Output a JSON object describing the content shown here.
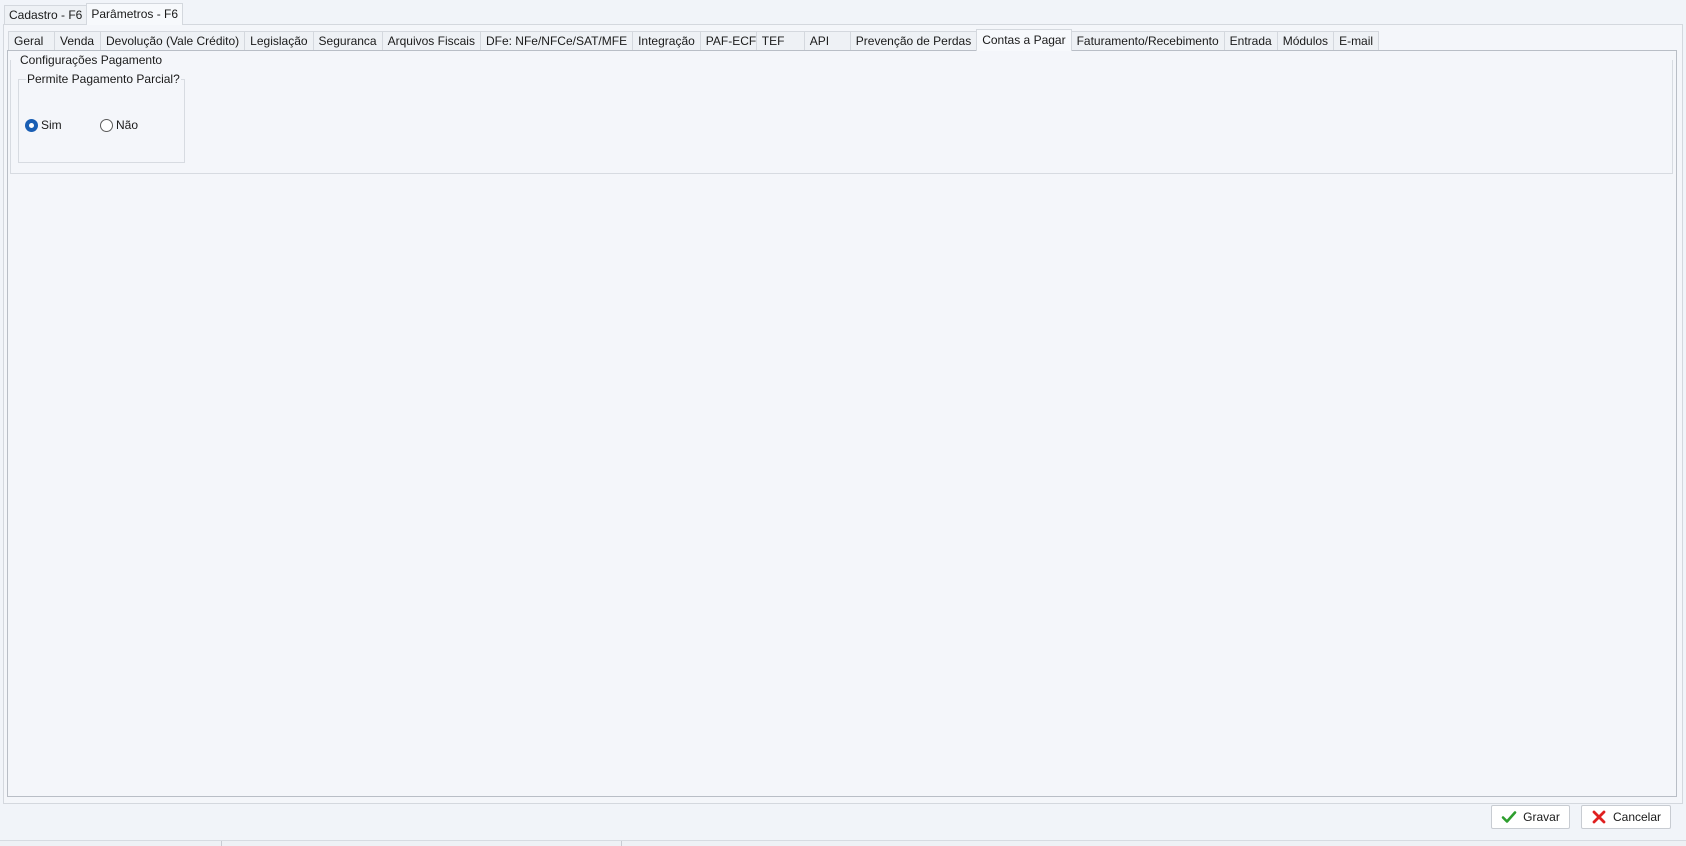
{
  "top_tabs": [
    {
      "label": "Cadastro - F6",
      "active": false
    },
    {
      "label": "Parâmetros - F6",
      "active": true
    }
  ],
  "inner_tabs": [
    {
      "label": "Geral"
    },
    {
      "label": "Venda"
    },
    {
      "label": "Devolução (Vale Crédito)"
    },
    {
      "label": "Legislação"
    },
    {
      "label": "Seguranca"
    },
    {
      "label": "Arquivos Fiscais"
    },
    {
      "label": "DFe: NFe/NFCe/SAT/MFE"
    },
    {
      "label": "Integração"
    },
    {
      "label": "PAF-ECF"
    },
    {
      "label": "TEF"
    },
    {
      "label": "API"
    },
    {
      "label": "Prevenção de Perdas"
    },
    {
      "label": "Contas a Pagar"
    },
    {
      "label": "Faturamento/Recebimento"
    },
    {
      "label": "Entrada"
    },
    {
      "label": "Módulos"
    },
    {
      "label": "E-mail"
    }
  ],
  "active_inner_tab": "Contas a Pagar",
  "group": {
    "title": "Configurações Pagamento",
    "subgroup_title": "Permite Pagamento Parcial?",
    "options": [
      {
        "label": "Sim",
        "checked": true
      },
      {
        "label": "Não",
        "checked": false
      }
    ]
  },
  "buttons": {
    "save_label": "Gravar",
    "cancel_label": "Cancelar"
  },
  "colors": {
    "accent": "#1a5fb4",
    "save_icon": "#2e9e2e",
    "cancel_icon": "#e02020"
  }
}
